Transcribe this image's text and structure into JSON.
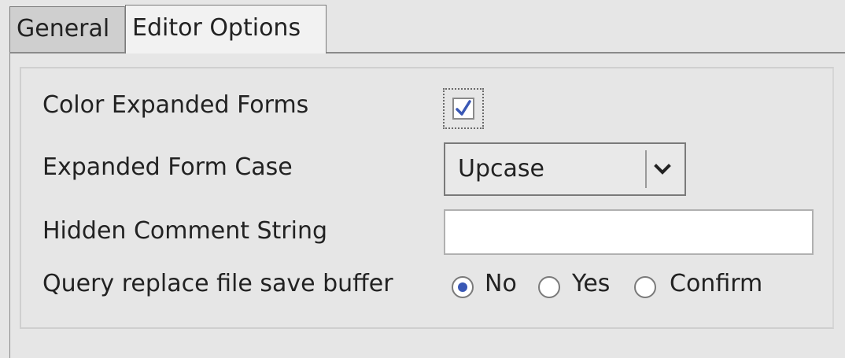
{
  "tabs": [
    {
      "label": "General",
      "active": false
    },
    {
      "label": "Editor Options",
      "active": true
    }
  ],
  "options": {
    "color_expanded_forms": {
      "label": "Color Expanded Forms",
      "checked": true
    },
    "expanded_form_case": {
      "label": "Expanded Form Case",
      "value": "Upcase"
    },
    "hidden_comment_string": {
      "label": "Hidden Comment String",
      "value": ""
    },
    "query_replace": {
      "label": "Query replace file save buffer",
      "options": [
        "No",
        "Yes",
        "Confirm"
      ],
      "selected": "No"
    }
  },
  "colors": {
    "accent": "#3a58b5",
    "background": "#e6e6e6"
  },
  "icons": {
    "checkmark": "check-icon",
    "dropdown": "chevron-down-icon"
  }
}
